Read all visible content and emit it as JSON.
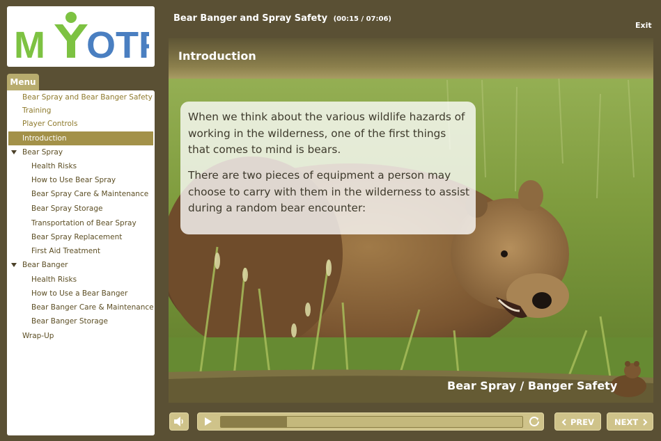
{
  "logo": {
    "text": "MYOTF"
  },
  "menu": {
    "tab_label": "Menu",
    "items": [
      {
        "label": "Bear Spray and Bear Banger Safety"
      },
      {
        "label": "Training"
      },
      {
        "label": "Player Controls"
      },
      {
        "label": "Introduction"
      },
      {
        "label": "Bear Spray"
      },
      {
        "label": "Health Risks"
      },
      {
        "label": "How to Use Bear Spray"
      },
      {
        "label": "Bear Spray Care & Maintenance"
      },
      {
        "label": "Bear Spray Storage"
      },
      {
        "label": "Transportation of Bear Spray"
      },
      {
        "label": "Bear Spray Replacement"
      },
      {
        "label": "First Aid Treatment"
      },
      {
        "label": "Bear Banger"
      },
      {
        "label": "Health Risks"
      },
      {
        "label": "How to Use a Bear Banger"
      },
      {
        "label": "Bear Banger Care & Maintenance"
      },
      {
        "label": "Bear Banger Storage"
      },
      {
        "label": "Wrap-Up"
      }
    ],
    "active_item": "Introduction"
  },
  "header": {
    "course_title": "Bear Banger and Spray Safety",
    "time": "(00:15 / 07:06)",
    "exit_label": "Exit"
  },
  "slide": {
    "title": "Introduction",
    "paragraph1": "When we think about the various wildlife hazards of working in the wilderness, one of the first things that comes to mind is bears.",
    "paragraph2": "There are two pieces of equipment a person may choose to carry with them in the wilderness to assist during a random bear encounter:",
    "footer_brand": "Bear Spray / Banger Safety"
  },
  "controls": {
    "prev_label": "PREV",
    "next_label": "NEXT",
    "progress_fraction": 0.22
  },
  "colors": {
    "background": "#5a5034",
    "accent_gold": "#b8ac6e",
    "active_menu": "#a39149",
    "logo_green": "#7dc242",
    "logo_blue": "#4a7fc1"
  }
}
